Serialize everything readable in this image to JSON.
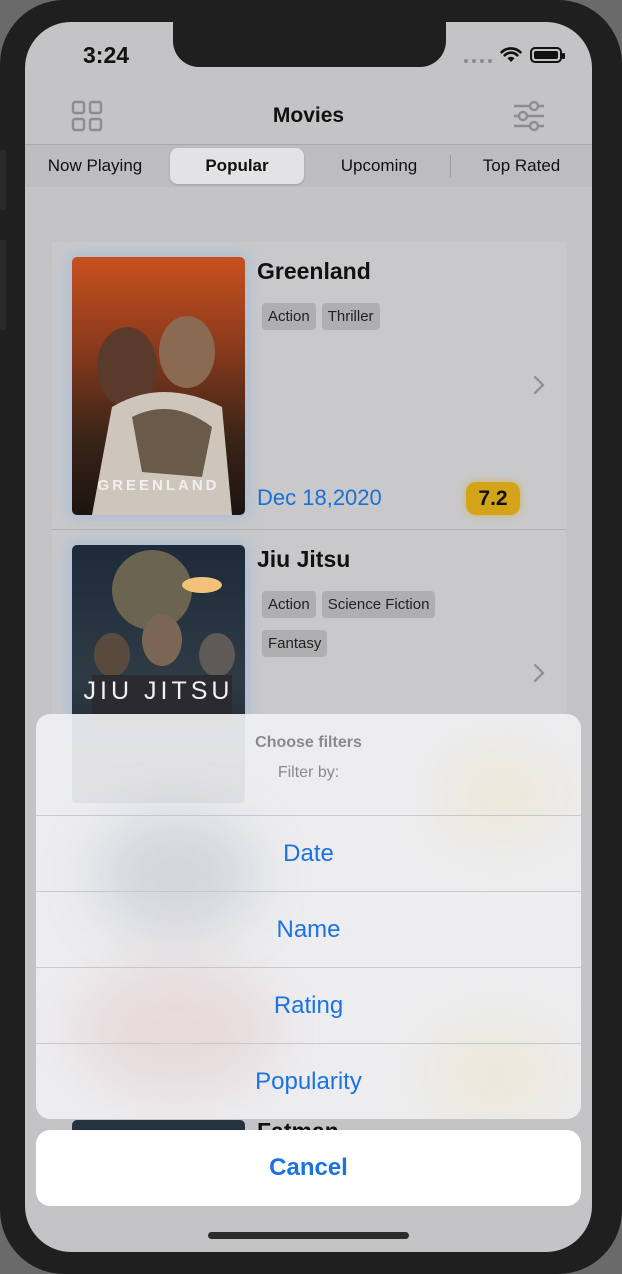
{
  "status": {
    "time": "3:24"
  },
  "nav": {
    "title": "Movies",
    "left_icon": "grid-icon",
    "right_icon": "sliders-icon"
  },
  "segments": [
    {
      "label": "Now Playing",
      "active": false
    },
    {
      "label": "Popular",
      "active": true
    },
    {
      "label": "Upcoming",
      "active": false
    },
    {
      "label": "Top Rated",
      "active": false
    }
  ],
  "movies": [
    {
      "title": "Greenland",
      "genres": [
        "Action",
        "Thriller"
      ],
      "release": "Dec 18,2020",
      "rating": "7.2",
      "poster_text": "GREENLAND"
    },
    {
      "title": "Jiu Jitsu",
      "genres": [
        "Action",
        "Science Fiction",
        "Fantasy"
      ],
      "poster_text": "JIU JITSU"
    }
  ],
  "next_movie_partial_title": "Fatman",
  "action_sheet": {
    "title": "Choose filters",
    "message": "Filter by:",
    "actions": [
      "Date",
      "Name",
      "Rating",
      "Popularity"
    ],
    "cancel": "Cancel"
  },
  "colors": {
    "accent": "#1b73e0",
    "rating_badge": "#d4a418",
    "date_text": "#1b6fd6"
  }
}
